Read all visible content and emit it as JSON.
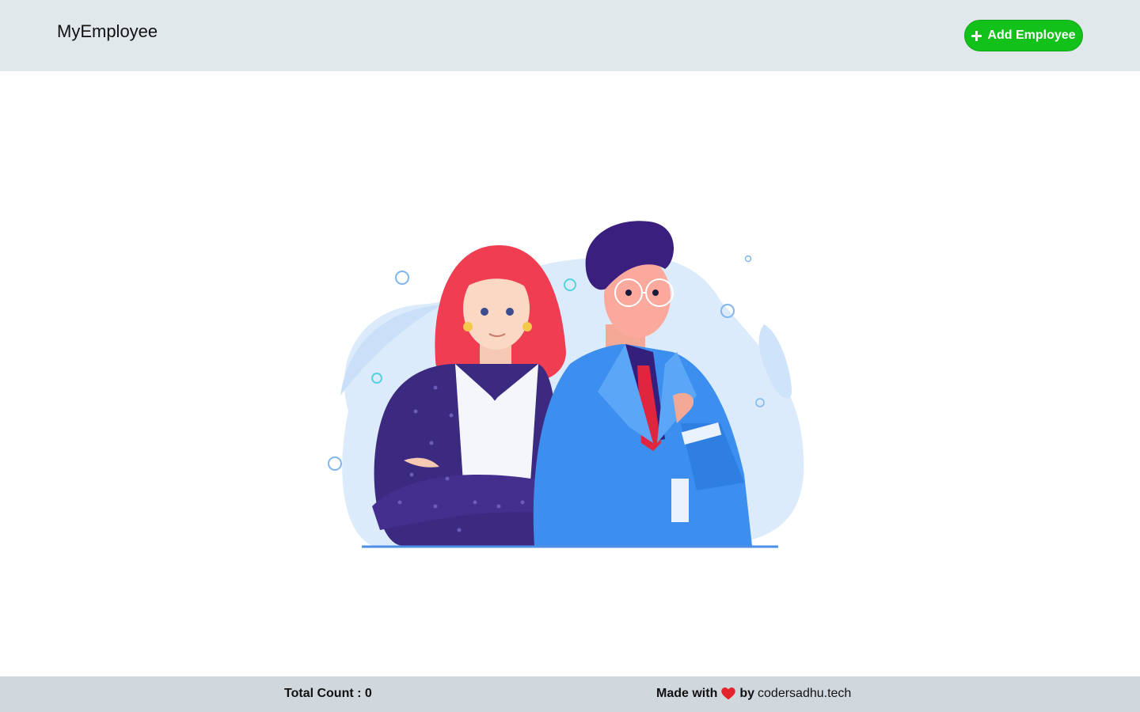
{
  "navbar": {
    "brand": "MyEmployee",
    "add_button_label": "Add Employee",
    "add_button_icon": "plus-icon",
    "add_button_color": "#13c11b"
  },
  "illustration": {
    "subject": "two employees illustration"
  },
  "footer": {
    "total_label": "Total Count : 0",
    "made_with": "Made with",
    "heart_icon": "heart-icon",
    "by": "by",
    "link_text": "codersadhu.tech"
  }
}
